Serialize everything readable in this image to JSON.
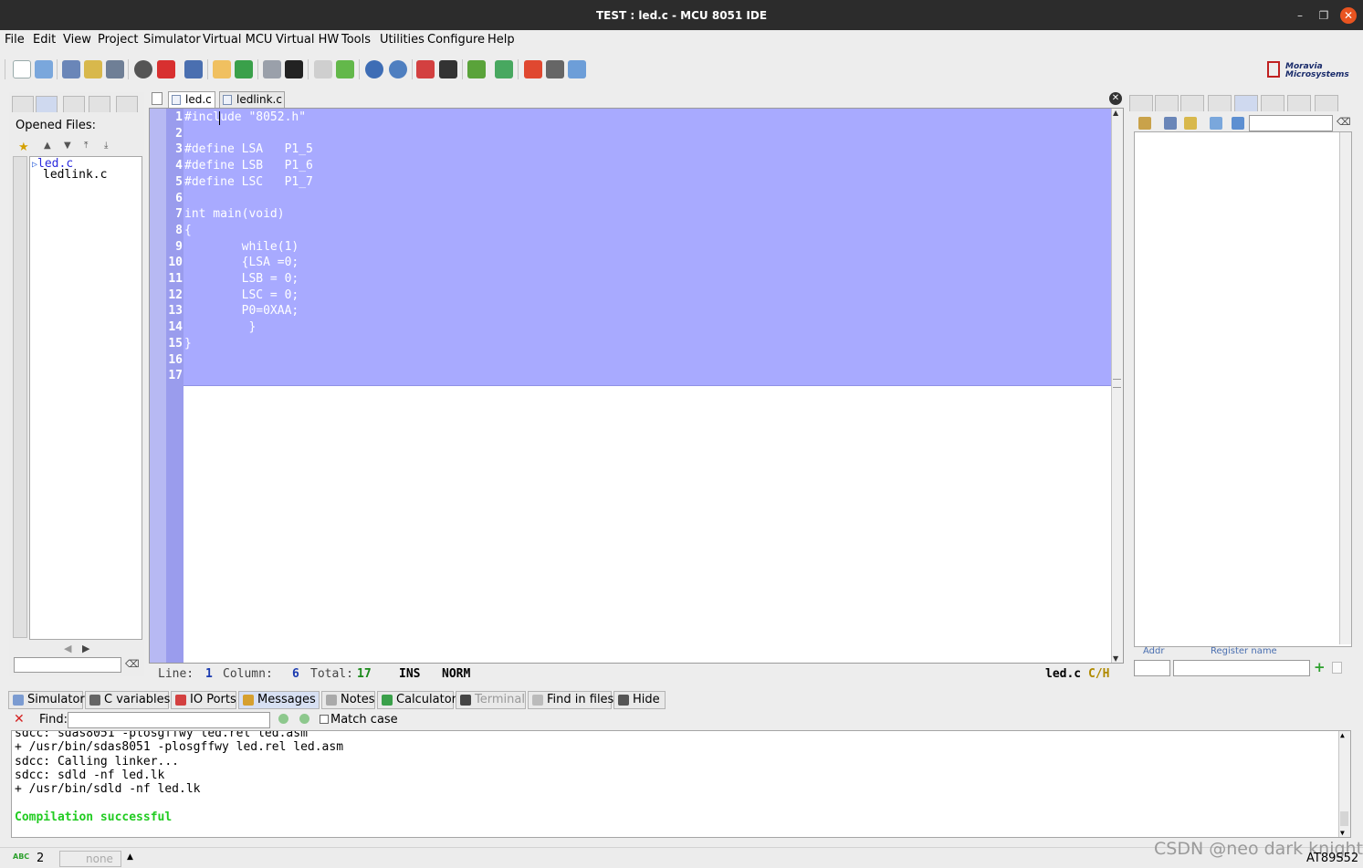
{
  "window": {
    "title": "TEST : led.c - MCU 8051 IDE",
    "minimize": "–",
    "restore": "❐",
    "close": "✕"
  },
  "menu": [
    "File",
    "Edit",
    "View",
    "Project",
    "Simulator",
    "Virtual MCU",
    "Virtual HW",
    "Tools",
    "Utilities",
    "Configure",
    "Help"
  ],
  "logo": {
    "line1": "Moravia",
    "line2": "Microsystems"
  },
  "left_panel": {
    "heading": "Opened Files:",
    "files": [
      {
        "name": "led.c",
        "active": true
      },
      {
        "name": "ledlink.c",
        "active": false
      }
    ],
    "filter_value": ""
  },
  "editor": {
    "tabs": [
      {
        "label": "led.c",
        "active": true
      },
      {
        "label": "ledlink.c",
        "active": false
      }
    ],
    "lines": [
      "#include \"8052.h\"",
      "",
      "#define LSA   P1_5",
      "#define LSB   P1_6",
      "#define LSC   P1_7",
      "",
      "int main(void)",
      "{",
      "        while(1)",
      "        {LSA =0;",
      "        LSB = 0;",
      "        LSC = 0;",
      "        P0=0XAA;",
      "         }",
      "}",
      "",
      ""
    ],
    "line_numbers": [
      "1",
      "2",
      "3",
      "4",
      "5",
      "6",
      "7",
      "8",
      "9",
      "10",
      "11",
      "12",
      "13",
      "14",
      "15",
      "16",
      "17"
    ],
    "status": {
      "line_label": "Line:",
      "line": "1",
      "column_label": "Column:",
      "column": "6",
      "total_label": "Total:",
      "total": "17",
      "ins": "INS",
      "mode": "NORM",
      "file": "led.c",
      "type": "C/H"
    }
  },
  "right_panel": {
    "col_addr": "Addr",
    "col_register": "Register name",
    "search_value": ""
  },
  "bottom_tabs": [
    {
      "label": "Simulator",
      "active": false,
      "disabled": false
    },
    {
      "label": "C variables",
      "active": false,
      "disabled": false
    },
    {
      "label": "IO Ports",
      "active": false,
      "disabled": false
    },
    {
      "label": "Messages",
      "active": true,
      "disabled": false
    },
    {
      "label": "Notes",
      "active": false,
      "disabled": false
    },
    {
      "label": "Calculator",
      "active": false,
      "disabled": false
    },
    {
      "label": "Terminal",
      "active": false,
      "disabled": true
    },
    {
      "label": "Find in files",
      "active": false,
      "disabled": false
    },
    {
      "label": "Hide",
      "active": false,
      "disabled": false
    }
  ],
  "find": {
    "label": "Find:",
    "value": "",
    "match_case": "Match case"
  },
  "messages": [
    {
      "text": "sdcc: sdas8051 -plosgffwy led.rel led.asm",
      "color": "#000000"
    },
    {
      "text": "+ /usr/bin/sdas8051 -plosgffwy led.rel led.asm",
      "color": "#000000"
    },
    {
      "text": "sdcc: Calling linker...",
      "color": "#000000"
    },
    {
      "text": "sdcc: sdld -nf led.lk",
      "color": "#000000"
    },
    {
      "text": "+ /usr/bin/sdld -nf led.lk",
      "color": "#000000"
    },
    {
      "text": "",
      "color": "#000000"
    },
    {
      "text": "Compilation successful",
      "color": "#22cc22"
    }
  ],
  "statusbar": {
    "count": "2",
    "none": "none",
    "mcu": "AT89S52",
    "watermark": "CSDN @neo dark knight"
  },
  "colors": {
    "selection": "#a8aaff",
    "gutter": "#9a9ced",
    "success": "#22cc22",
    "titlebar": "#2c2c2c",
    "close": "#e95420"
  }
}
